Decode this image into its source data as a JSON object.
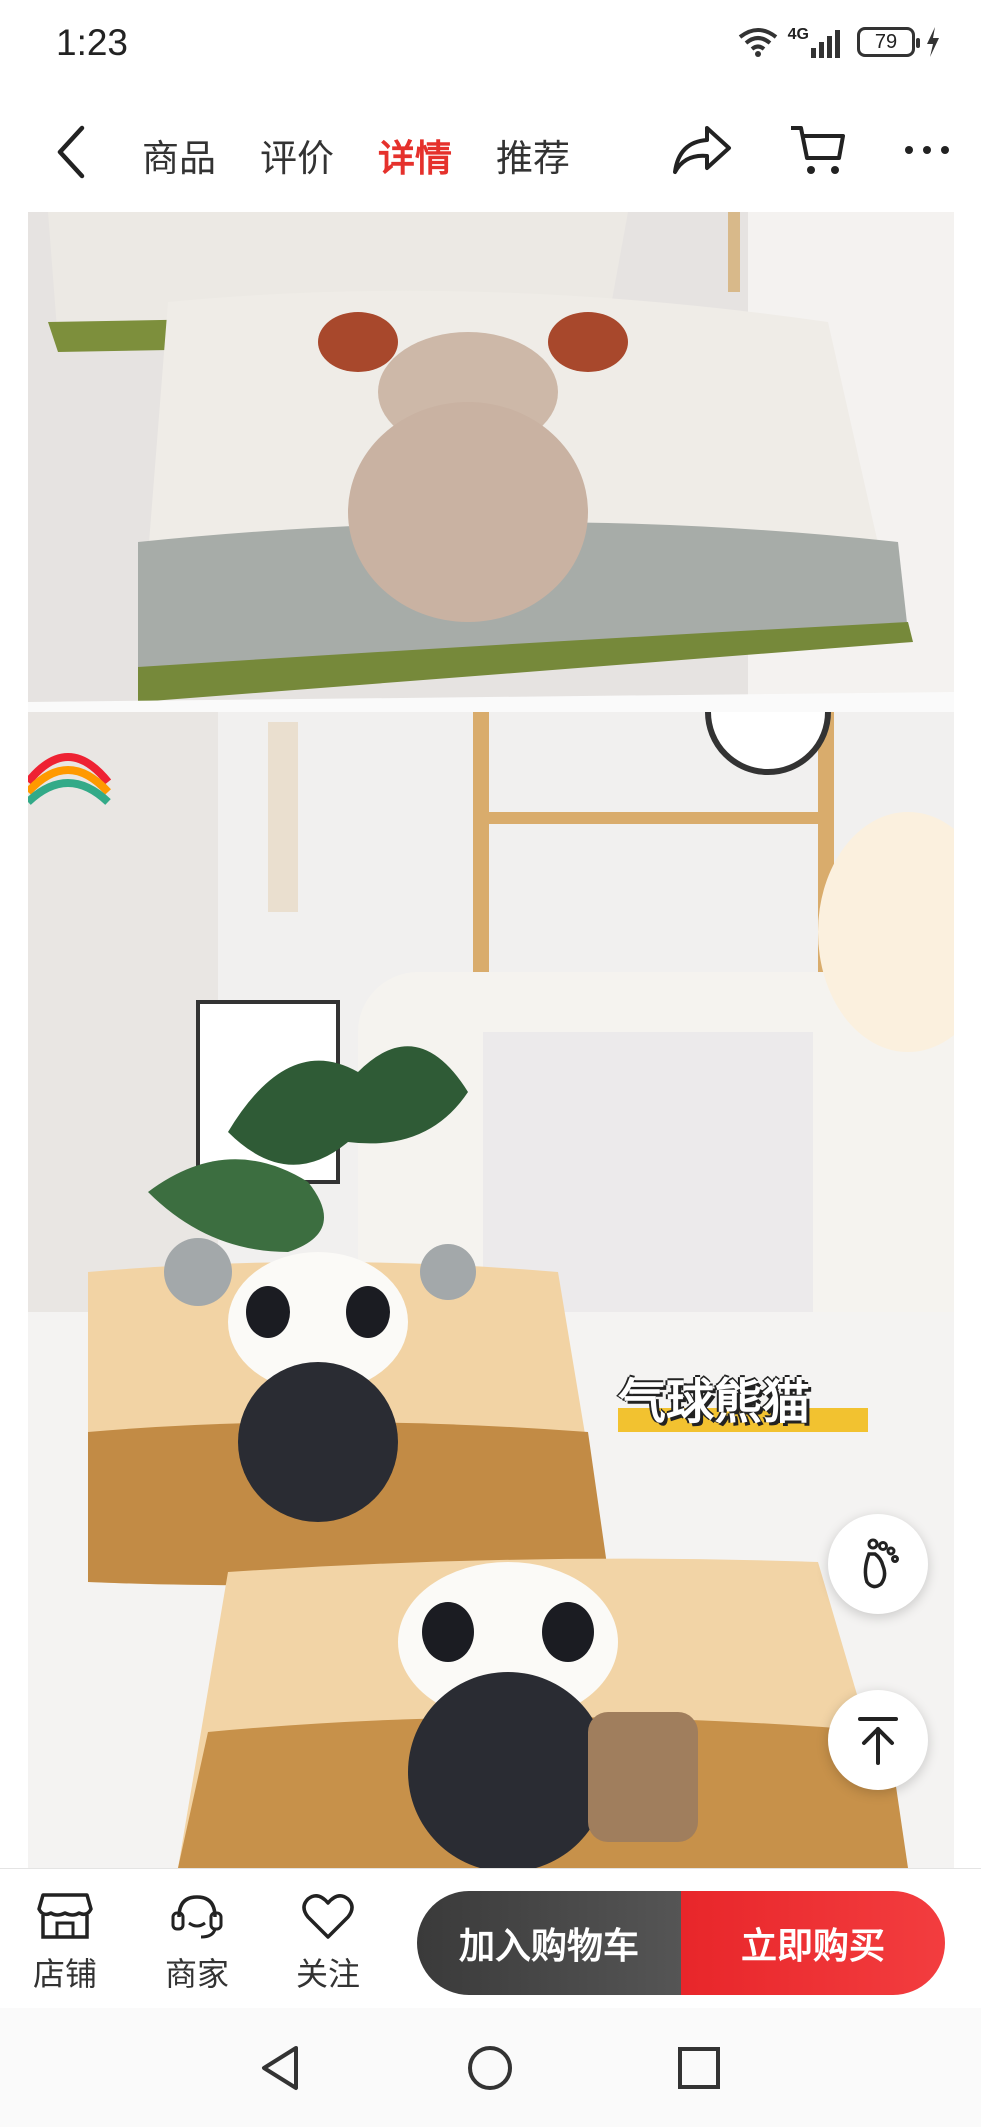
{
  "status": {
    "time": "1:23",
    "network": "4G",
    "battery": "79"
  },
  "nav": {
    "tabs": [
      {
        "label": "商品",
        "active": false
      },
      {
        "label": "评价",
        "active": false
      },
      {
        "label": "详情",
        "active": true
      },
      {
        "label": "推荐",
        "active": false
      }
    ]
  },
  "content": {
    "image2_caption": "气球熊猫"
  },
  "bottom": {
    "shop_label": "店铺",
    "merchant_label": "商家",
    "follow_label": "关注",
    "add_to_cart": "加入购物车",
    "buy_now": "立即购买"
  },
  "colors": {
    "accent": "#e5312c",
    "cart_bg": "#444444",
    "buy_bg": "#ee2a2d"
  }
}
